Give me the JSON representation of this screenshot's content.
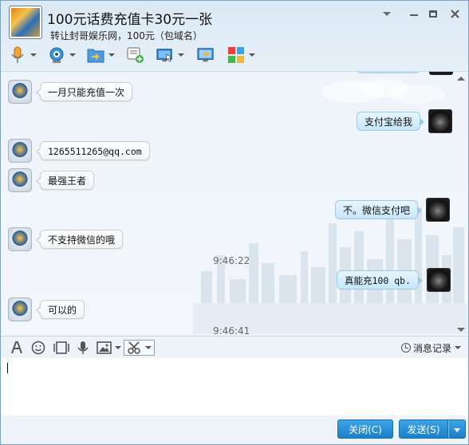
{
  "window": {
    "title": "100元话费充值卡30元一张",
    "subtitle": "转让封哥娱乐网，100元（包域名）"
  },
  "toolbar": {
    "icons": [
      "microphone-icon",
      "webcam-icon",
      "folder-transfer-icon",
      "add-note-icon",
      "remote-desktop-icon",
      "screen-share-icon",
      "apps-grid-icon"
    ]
  },
  "messages": [
    {
      "side": "left",
      "text": "一月只能充值一次"
    },
    {
      "side": "right",
      "text": "支付宝给我"
    },
    {
      "side": "left",
      "text": "1265511265@qq.com"
    },
    {
      "side": "left",
      "text": "最强王者"
    },
    {
      "side": "right",
      "text": "不。微信支付吧"
    },
    {
      "side": "left",
      "text": "不支持微信的哦"
    },
    {
      "side": "time",
      "text": "9:46:22"
    },
    {
      "side": "right",
      "text": "真能充100 qb."
    },
    {
      "side": "left",
      "text": "可以的"
    },
    {
      "side": "time",
      "text": "9:46:41"
    }
  ],
  "input_toolbar": {
    "icons": [
      "font-icon",
      "emoji-icon",
      "image-gallery-icon",
      "voice-icon",
      "picture-icon",
      "scissors-icon"
    ],
    "history_label": "消息记录"
  },
  "buttons": {
    "close_label": "关闭(C)",
    "send_label": "发送(S)"
  },
  "colors": {
    "accent": "#1c7fc8",
    "bubble_right": "#c7e6fb",
    "bubble_left": "#ffffff"
  }
}
